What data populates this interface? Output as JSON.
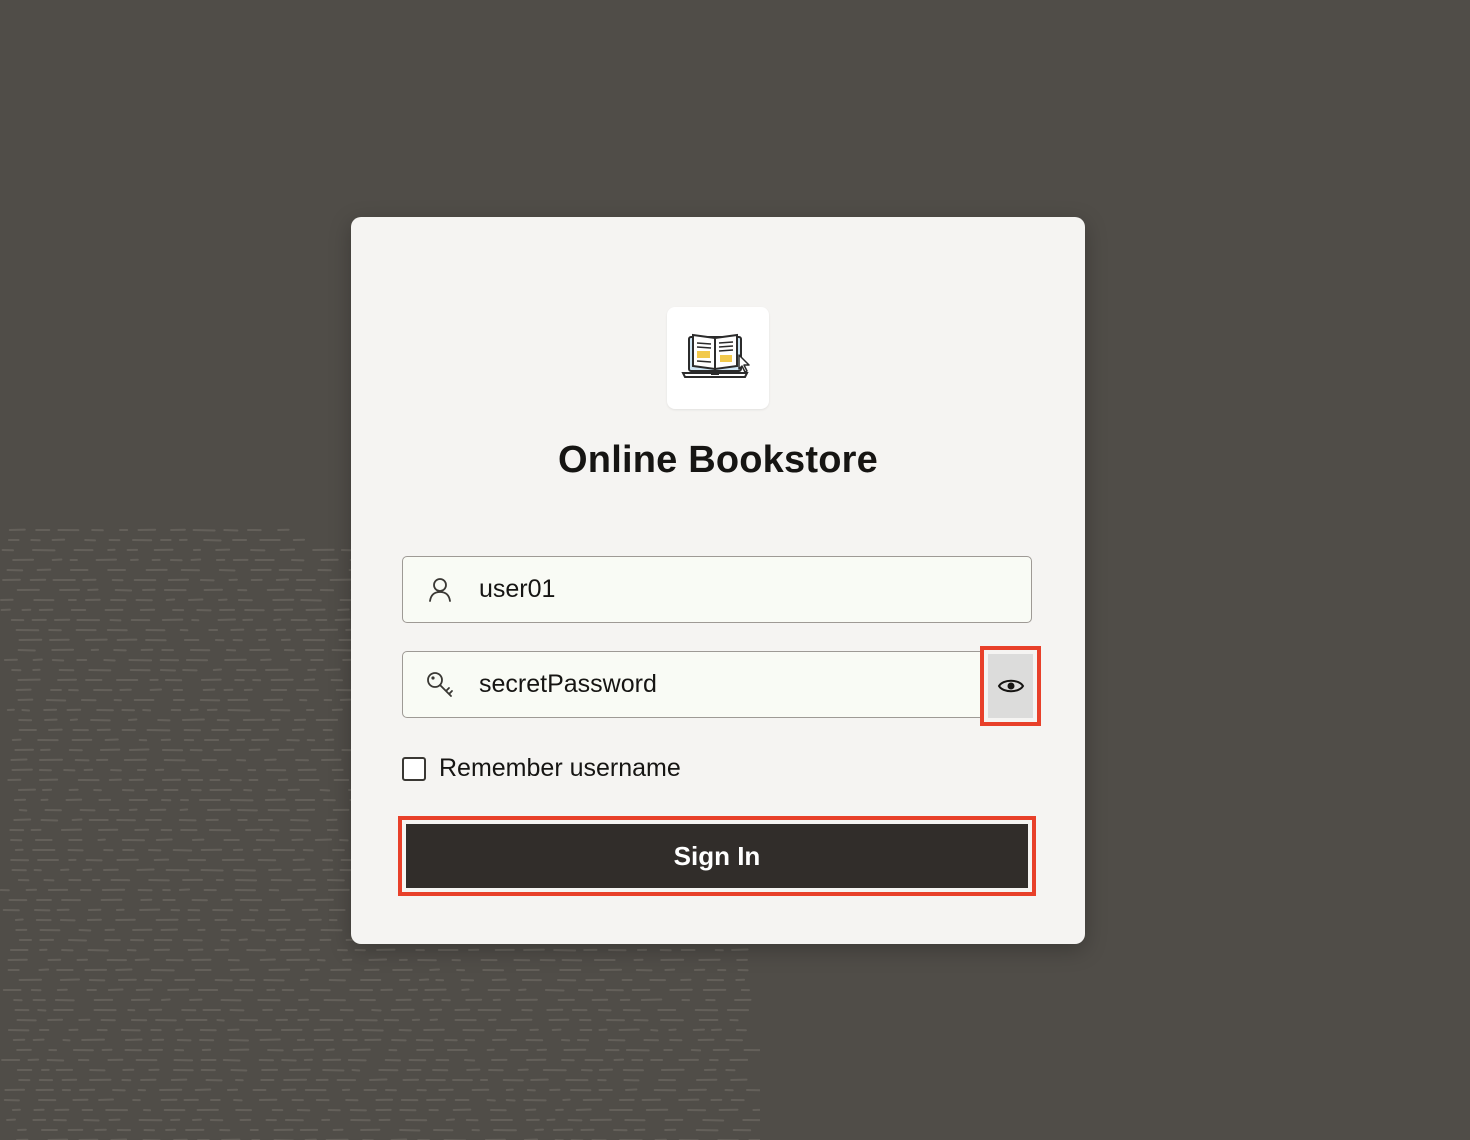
{
  "app": {
    "title": "Online Bookstore",
    "logo_icon": "book-laptop-icon"
  },
  "form": {
    "username_value": "user01",
    "username_icon": "user-icon",
    "password_value": "secretPassword",
    "password_icon": "key-icon",
    "reveal_icon": "eye-icon",
    "remember_label": "Remember username",
    "remember_checked": false,
    "signin_label": "Sign In"
  },
  "colors": {
    "background": "#504d48",
    "card": "#f5f4f2",
    "button": "#312d2a",
    "highlight": "#e8402a"
  }
}
